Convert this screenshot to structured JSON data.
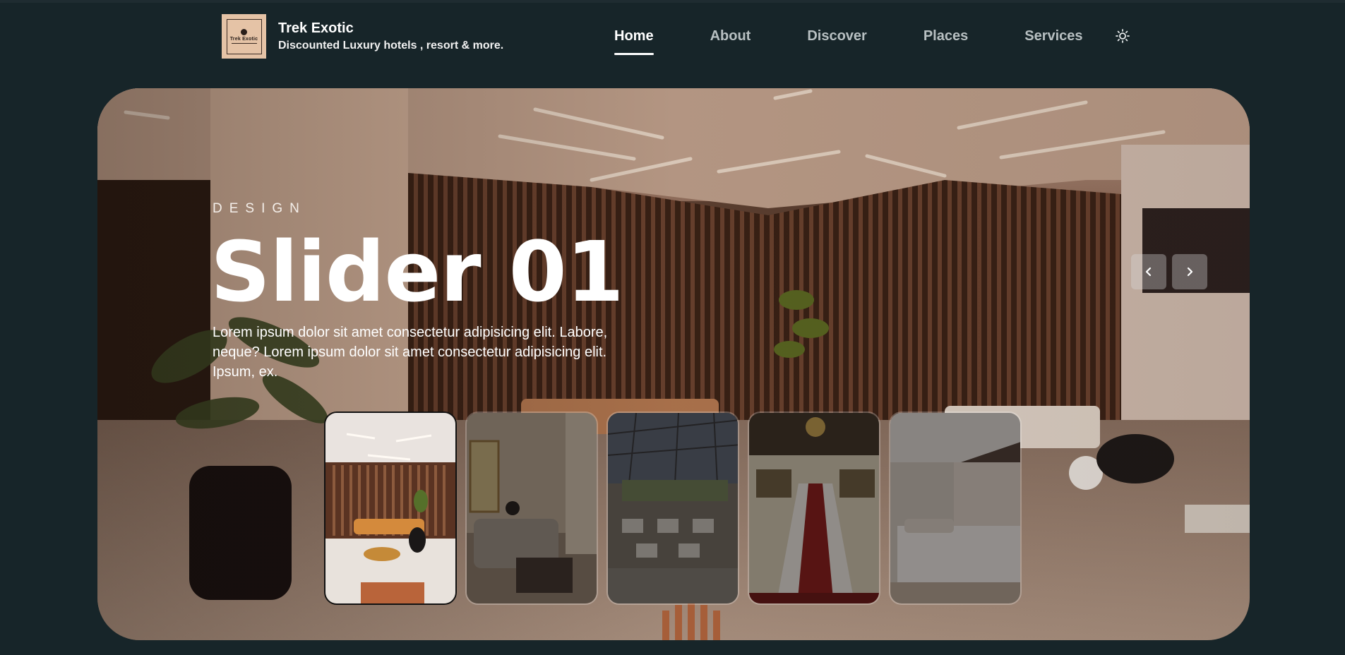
{
  "brand": {
    "logo_text": "Trek Exotic",
    "title": "Trek Exotic",
    "subtitle": "Discounted Luxury hotels , resort & more."
  },
  "nav": {
    "items": [
      {
        "label": "Home",
        "active": true
      },
      {
        "label": "About",
        "active": false
      },
      {
        "label": "Discover",
        "active": false
      },
      {
        "label": "Places",
        "active": false
      },
      {
        "label": "Services",
        "active": false
      }
    ],
    "theme_icon": "sun-icon"
  },
  "hero": {
    "kicker": "DESIGN",
    "title": "Slider 01",
    "description": "Lorem ipsum dolor sit amet consectetur adipisicing elit. Labore, neque? Lorem ipsum dolor sit amet consectetur adipisicing elit. Ipsum, ex.",
    "prev_icon": "chevron-left-icon",
    "next_icon": "chevron-right-icon"
  },
  "thumbnails": [
    {
      "name": "lobby-lounge",
      "active": true
    },
    {
      "name": "classic-living-room",
      "active": false
    },
    {
      "name": "glass-dining-hall",
      "active": false
    },
    {
      "name": "grand-staircase",
      "active": false
    },
    {
      "name": "hotel-bedroom",
      "active": false
    }
  ],
  "colors": {
    "background": "#172529",
    "text": "#ffffff",
    "nav_inactive": "#b8c0c2",
    "logo_bg": "#e5c3a6"
  }
}
